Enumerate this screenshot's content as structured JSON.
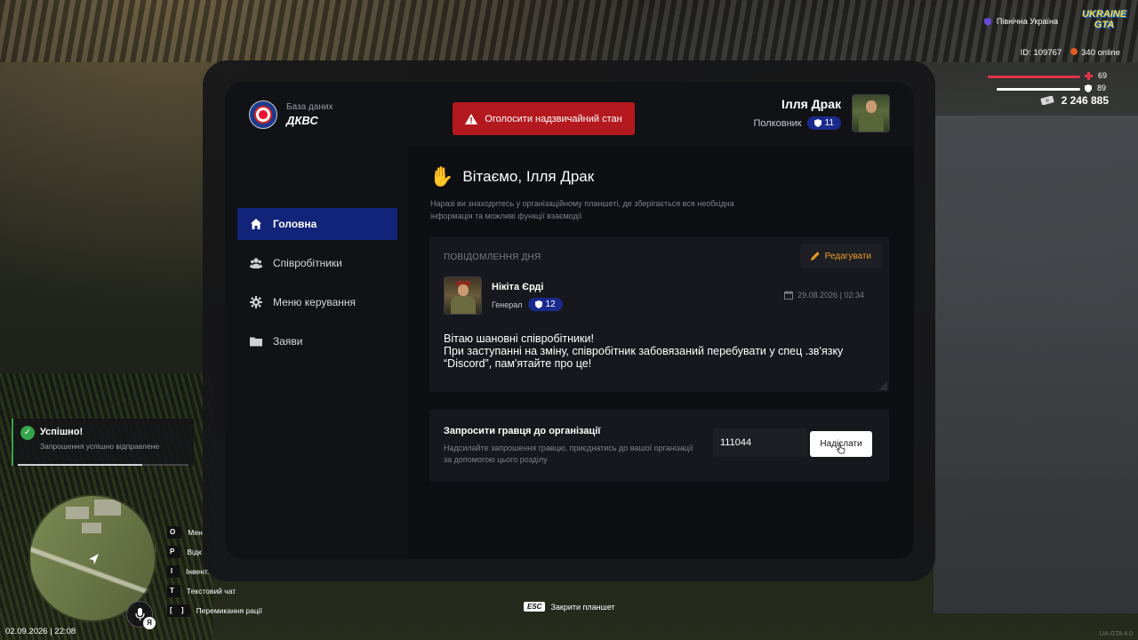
{
  "org": {
    "subtitle": "База даних",
    "name": "ДКВС"
  },
  "header": {
    "emergency_label": "Оголосити надзвичайний стан",
    "user_name": "Ілля Драк",
    "user_rank": "Полковник",
    "user_rank_level": "11"
  },
  "sidebar": {
    "items": [
      {
        "label": "Головна",
        "icon": "home-icon",
        "active": true
      },
      {
        "label": "Співробітники",
        "icon": "users-icon",
        "active": false
      },
      {
        "label": "Меню керування",
        "icon": "gear-icon",
        "active": false
      },
      {
        "label": "Заяви",
        "icon": "folder-icon",
        "active": false
      }
    ]
  },
  "main": {
    "welcome": "Вітаємо, Ілля Драк",
    "intro": "Наразі ви знаходитесь у організаційному планшеті, де зберігається вся необхідна інформація та можливі функції взаємодії"
  },
  "motd": {
    "label": "ПОВІДОМЛЕННЯ ДНЯ",
    "edit_label": "Редагувати",
    "author_name": "Нікіта Єрді",
    "author_rank": "Генерал",
    "author_rank_level": "12",
    "date": "29.08.2026 | 02:34",
    "message": "Вітаю шановні співробітники!\nПри заступанні на зміну, співробітник забовязаний перебувати у спец .зв'язку “Discord”, пам'ятайте про це!"
  },
  "invite": {
    "title": "Запросити гравця до організації",
    "description": "Надсилайте запрошення гравцю, приєднатись до вашої організації за допомогою цього розділу",
    "input_value": "111044",
    "send_label": "Надіслати"
  },
  "hud": {
    "region": "Північна Україна",
    "logo_text": "UKRAINE GTA",
    "id_label": "ID: 109767",
    "online": "340 online",
    "health": "69",
    "armor": "89",
    "money": "2 246 885",
    "health_color": "#e0344a",
    "armor_color": "#ffffff"
  },
  "notification": {
    "title": "Успішно!",
    "text": "Запрошення успішно відправлене",
    "progress": 0.73
  },
  "keybinds": [
    {
      "key": "O",
      "label": "Мен"
    },
    {
      "key": "P",
      "label": "Відк"
    },
    {
      "key": "I",
      "label": "Інвент."
    },
    {
      "key": "T",
      "label": "Текстовий чат"
    },
    {
      "key": "[ ]",
      "label": "Перемикання рації"
    }
  ],
  "footer": {
    "datetime": "02.09.2026 | 22:08",
    "esc_key": "ESC",
    "esc_label": "Закрити планшет",
    "version": "UA-GTA 4.0",
    "lang": "Я"
  }
}
